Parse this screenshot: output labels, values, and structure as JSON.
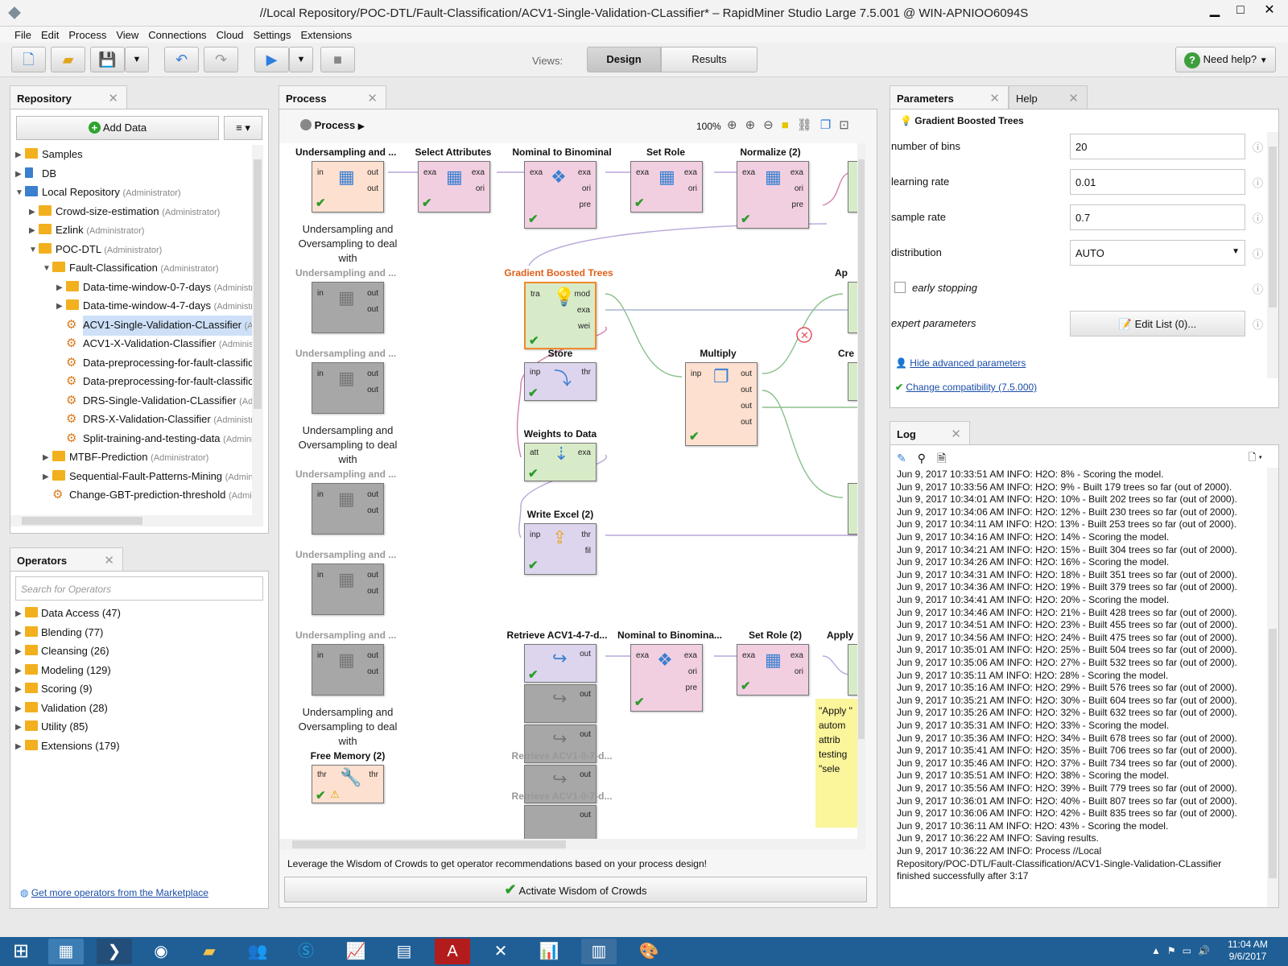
{
  "window": {
    "title": "//Local Repository/POC-DTL/Fault-Classification/ACV1-Single-Validation-CLassifier* – RapidMiner Studio Large 7.5.001 @ WIN-APNIOO6094S"
  },
  "menu": [
    "File",
    "Edit",
    "Process",
    "View",
    "Connections",
    "Cloud",
    "Settings",
    "Extensions"
  ],
  "toolbar": {
    "views_label": "Views:",
    "design": "Design",
    "results": "Results",
    "need_help": "Need help?"
  },
  "repository": {
    "tab": "Repository",
    "add_data": "Add Data",
    "items": [
      {
        "label": "Samples",
        "meta": ""
      },
      {
        "label": "DB",
        "meta": ""
      },
      {
        "label": "Local Repository",
        "meta": "(Administrator)"
      },
      {
        "label": "Crowd-size-estimation",
        "meta": "(Administrator)"
      },
      {
        "label": "Ezlink",
        "meta": "(Administrator)"
      },
      {
        "label": "POC-DTL",
        "meta": "(Administrator)"
      },
      {
        "label": "Fault-Classification",
        "meta": "(Administrator)"
      },
      {
        "label": "Data-time-window-0-7-days",
        "meta": "(Administrator"
      },
      {
        "label": "Data-time-window-4-7-days",
        "meta": "(Administrator"
      },
      {
        "label": "ACV1-Single-Validation-CLassifier",
        "meta": "(Adm"
      },
      {
        "label": "ACV1-X-Validation-Classifier",
        "meta": "(Administrat"
      },
      {
        "label": "Data-preprocessing-for-fault-classificat",
        "meta": ""
      },
      {
        "label": "Data-preprocessing-for-fault-classificat",
        "meta": ""
      },
      {
        "label": "DRS-Single-Validation-CLassifier",
        "meta": "(Admi"
      },
      {
        "label": "DRS-X-Validation-Classifier",
        "meta": "(Administrat"
      },
      {
        "label": "Split-training-and-testing-data",
        "meta": "(Administr"
      },
      {
        "label": "MTBF-Prediction",
        "meta": "(Administrator)"
      },
      {
        "label": "Sequential-Fault-Patterns-Mining",
        "meta": "(Administr"
      },
      {
        "label": "Change-GBT-prediction-threshold",
        "meta": "(Administ"
      }
    ]
  },
  "operators": {
    "tab": "Operators",
    "search_placeholder": "Search for Operators",
    "groups": [
      "Data Access (47)",
      "Blending (77)",
      "Cleansing (26)",
      "Modeling (129)",
      "Scoring (9)",
      "Validation (28)",
      "Utility (85)",
      "Extensions (179)"
    ],
    "marketplace": "Get more operators from the Marketplace"
  },
  "process": {
    "tab": "Process",
    "breadcrumb": "Process",
    "zoom": "100%",
    "wisdom_text": "Leverage the Wisdom of Crowds to get operator recommendations based on your process design!",
    "activate": "Activate Wisdom of Crowds",
    "nodes": {
      "undersampling": "Undersampling and ...",
      "select_attributes": "Select Attributes",
      "nominal_binominal": "Nominal to Binominal",
      "set_role": "Set Role",
      "normalize": "Normalize (2)",
      "gbt": "Gradient Boosted Trees",
      "store": "Store",
      "multiply": "Multiply",
      "weights_to_data": "Weights to Data",
      "write_excel": "Write Excel (2)",
      "retrieve": "Retrieve ACV1-4-7-d...",
      "nominal_binomina2": "Nominal to Binomina...",
      "set_role2": "Set Role (2)",
      "apply": "Apply",
      "free_memory": "Free Memory (2)",
      "retrieve_b": "Retrieve ACV1-0-7-d...",
      "retrieve_c": "Retrieve ACV1-0-7-d...",
      "ap": "Ap",
      "cr": "Cre"
    },
    "annotation": "Undersampling and Oversampling to deal with",
    "sticky": "\"Apply \" autom attrib testing \"sele",
    "ports": {
      "inp": "inp",
      "in": "in",
      "out": "out",
      "exa": "exa",
      "ori": "ori",
      "pre": "pre",
      "tra": "tra",
      "mod": "mod",
      "wei": "wei",
      "thr": "thr",
      "att": "att",
      "fil": "fil"
    }
  },
  "parameters": {
    "tab": "Parameters",
    "help_tab": "Help",
    "operator": "Gradient Boosted Trees",
    "rows": [
      {
        "label": "number of bins",
        "value": "20"
      },
      {
        "label": "learning rate",
        "value": "0.01"
      },
      {
        "label": "sample rate",
        "value": "0.7"
      },
      {
        "label": "distribution",
        "value": "AUTO"
      }
    ],
    "early_stopping": "early stopping",
    "expert_parameters": "expert parameters",
    "edit_list": "Edit List (0)...",
    "hide_advanced": "Hide advanced parameters",
    "compat": "Change compatibility (7.5.000)"
  },
  "log": {
    "tab": "Log",
    "lines": [
      "Jun 9, 2017 10:33:51 AM INFO: H2O: 8% - Scoring the model.",
      "Jun 9, 2017 10:33:56 AM INFO: H2O: 9% - Built 179 trees so far (out of 2000).",
      "Jun 9, 2017 10:34:01 AM INFO: H2O: 10% - Built 202 trees so far (out of 2000).",
      "Jun 9, 2017 10:34:06 AM INFO: H2O: 12% - Built 230 trees so far (out of 2000).",
      "Jun 9, 2017 10:34:11 AM INFO: H2O: 13% - Built 253 trees so far (out of 2000).",
      "Jun 9, 2017 10:34:16 AM INFO: H2O: 14% - Scoring the model.",
      "Jun 9, 2017 10:34:21 AM INFO: H2O: 15% - Built 304 trees so far (out of 2000).",
      "Jun 9, 2017 10:34:26 AM INFO: H2O: 16% - Scoring the model.",
      "Jun 9, 2017 10:34:31 AM INFO: H2O: 18% - Built 351 trees so far (out of 2000).",
      "Jun 9, 2017 10:34:36 AM INFO: H2O: 19% - Built 379 trees so far (out of 2000).",
      "Jun 9, 2017 10:34:41 AM INFO: H2O: 20% - Scoring the model.",
      "Jun 9, 2017 10:34:46 AM INFO: H2O: 21% - Built 428 trees so far (out of 2000).",
      "Jun 9, 2017 10:34:51 AM INFO: H2O: 23% - Built 455 trees so far (out of 2000).",
      "Jun 9, 2017 10:34:56 AM INFO: H2O: 24% - Built 475 trees so far (out of 2000).",
      "Jun 9, 2017 10:35:01 AM INFO: H2O: 25% - Built 504 trees so far (out of 2000).",
      "Jun 9, 2017 10:35:06 AM INFO: H2O: 27% - Built 532 trees so far (out of 2000).",
      "Jun 9, 2017 10:35:11 AM INFO: H2O: 28% - Scoring the model.",
      "Jun 9, 2017 10:35:16 AM INFO: H2O: 29% - Built 576 trees so far (out of 2000).",
      "Jun 9, 2017 10:35:21 AM INFO: H2O: 30% - Built 604 trees so far (out of 2000).",
      "Jun 9, 2017 10:35:26 AM INFO: H2O: 32% - Built 632 trees so far (out of 2000).",
      "Jun 9, 2017 10:35:31 AM INFO: H2O: 33% - Scoring the model.",
      "Jun 9, 2017 10:35:36 AM INFO: H2O: 34% - Built 678 trees so far (out of 2000).",
      "Jun 9, 2017 10:35:41 AM INFO: H2O: 35% - Built 706 trees so far (out of 2000).",
      "Jun 9, 2017 10:35:46 AM INFO: H2O: 37% - Built 734 trees so far (out of 2000).",
      "Jun 9, 2017 10:35:51 AM INFO: H2O: 38% - Scoring the model.",
      "Jun 9, 2017 10:35:56 AM INFO: H2O: 39% - Built 779 trees so far (out of 2000).",
      "Jun 9, 2017 10:36:01 AM INFO: H2O: 40% - Built 807 trees so far (out of 2000).",
      "Jun 9, 2017 10:36:06 AM INFO: H2O: 42% - Built 835 trees so far (out of 2000).",
      "Jun 9, 2017 10:36:11 AM INFO: H2O: 43% - Scoring the model.",
      "Jun 9, 2017 10:36:22 AM INFO: Saving results.",
      "Jun 9, 2017 10:36:22 AM INFO: Process //Local",
      "Repository/POC-DTL/Fault-Classification/ACV1-Single-Validation-CLassifier",
      "finished successfully after 3:17"
    ]
  },
  "taskbar": {
    "time": "11:04 AM",
    "date": "9/6/2017"
  },
  "colors": {
    "selection": "#cde0f7",
    "taskbar": "#1f5f96",
    "accent_blue": "#3a7fd0"
  }
}
